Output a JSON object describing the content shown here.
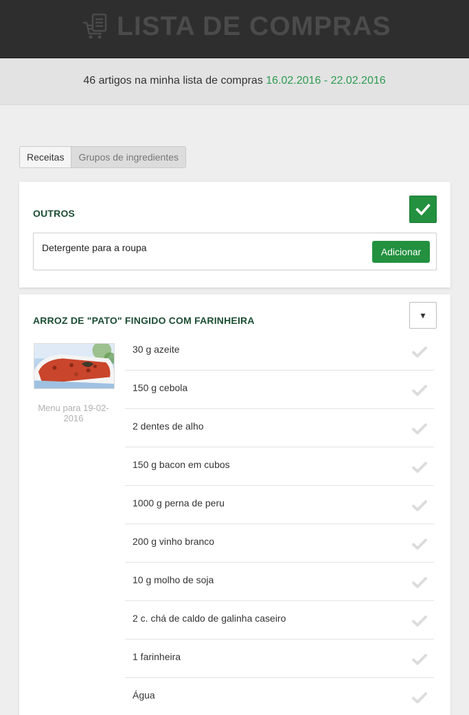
{
  "header": {
    "title": "LISTA DE COMPRAS",
    "logo_icon": "shopping-cart-list-icon"
  },
  "summary": {
    "text": "46 artigos na minha lista de compras",
    "date_range": "16.02.2016 - 22.02.2016",
    "date_color": "#2b9a4f"
  },
  "tabs": [
    {
      "label": "Receitas",
      "active": true
    },
    {
      "label": "Grupos de ingredientes",
      "active": false
    }
  ],
  "outros": {
    "title": "OUTROS",
    "input_value": "Detergente para a roupa",
    "add_label": "Adicionar",
    "check_icon": "check-icon"
  },
  "recipe": {
    "title": "ARROZ DE \"PATO\" FINGIDO COM FARINHEIRA",
    "dropdown_icon": "triangle-down-icon",
    "menu_date": "Menu para 19-02-2016",
    "ingredients": [
      "30 g azeite",
      "150 g cebola",
      "2 dentes de alho",
      "150 g bacon em cubos",
      "1000 g perna de peru",
      "200 g vinho branco",
      "10 g molho de soja",
      "2 c. chá de caldo de galinha caseiro",
      "1 farinheira",
      "Água"
    ]
  },
  "colors": {
    "accent": "#23913f",
    "topbar": "#2e2e2e",
    "title_green": "#1b4d32"
  }
}
